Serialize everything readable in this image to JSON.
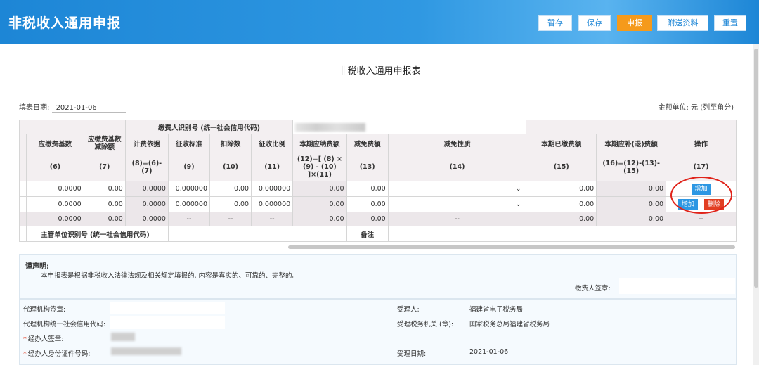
{
  "header": {
    "title": "非税收入通用申报",
    "buttons": {
      "save_temp": "暂存",
      "save": "保存",
      "declare": "申报",
      "attach": "附送资料",
      "reset": "重置"
    },
    "accent": "#1d86d6",
    "active_button_color": "#f59a1b"
  },
  "page_title": "非税收入通用申报表",
  "fill_date": {
    "label": "填表日期:",
    "value": "2021-01-06"
  },
  "unit_text": "金额单位: 元 (列至角分)",
  "payer": {
    "id_label": "缴费人识别号 (统一社会信用代码)"
  },
  "columns": {
    "headers": [
      "应缴费基数",
      "应缴费基数减除额",
      "计费依据",
      "征收标准",
      "扣除数",
      "征收比例",
      "本期应纳费额",
      "减免费额",
      "减免性质",
      "本期已缴费额",
      "本期应补(退)费额",
      "操作"
    ],
    "formulas": [
      "(6)",
      "(7)",
      "(8)=(6)-(7)",
      "(9)",
      "(10)",
      "(11)",
      "(12)=[ (8) × (9) - (10) ]×(11)",
      "(13)",
      "(14)",
      "(15)",
      "(16)=(12)-(13)-(15)",
      "(17)"
    ]
  },
  "rows": [
    {
      "c6": "0.0000",
      "c7": "0.00",
      "c8": "0.0000",
      "c9": "0.000000",
      "c10": "0.00",
      "c11": "0.000000",
      "c12": "0.00",
      "c13": "0.00",
      "c14": "",
      "c15": "0.00",
      "c16": "0.00",
      "add": "增加"
    },
    {
      "c6": "0.0000",
      "c7": "0.00",
      "c8": "0.0000",
      "c9": "0.000000",
      "c10": "0.00",
      "c11": "0.000000",
      "c12": "0.00",
      "c13": "0.00",
      "c14": "",
      "c15": "0.00",
      "c16": "0.00",
      "add": "增加",
      "del": "删除"
    },
    {
      "c6": "0.0000",
      "c7": "0.00",
      "c8": "0.0000",
      "c9": "--",
      "c10": "--",
      "c11": "--",
      "c12": "0.00",
      "c13": "0.00",
      "c14": "--",
      "c15": "0.00",
      "c16": "0.00",
      "op": "--"
    }
  ],
  "supervisor_label": "主管单位识别号 (统一社会信用代码)",
  "remark_label": "备注",
  "declaration": {
    "title": "谨声明:",
    "text": "本申报表是根据非税收入法律法规及相关规定填报的, 内容是真实的、可靠的、完整的。",
    "payer_sign": "缴费人签章:"
  },
  "bottom": {
    "agent_seal": "代理机构签章:",
    "agent_credit": "代理机构统一社会信用代码:",
    "handler_sign": "经办人签章:",
    "handler_id": "经办人身份证件号码:",
    "receiver_label": "受理人:",
    "receiver_value": "福建省电子税务局",
    "office_label": "受理税务机关 (章):",
    "office_value": "国家税务总局福建省税务局",
    "date_label": "受理日期:",
    "date_value": "2021-01-06"
  }
}
